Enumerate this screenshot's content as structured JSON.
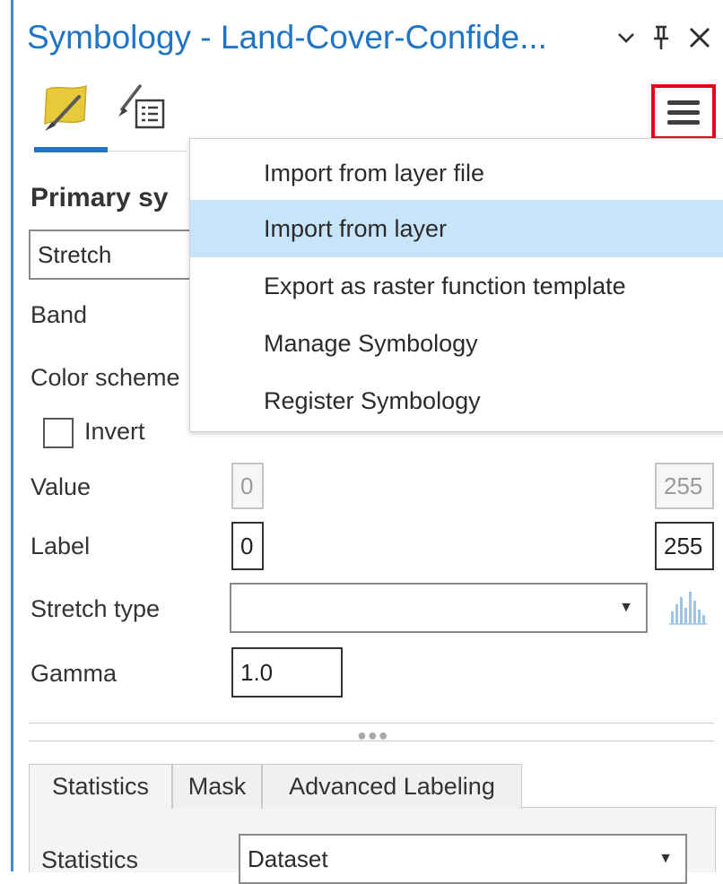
{
  "panel": {
    "title": "Symbology - Land-Cover-Confide...",
    "controls": {
      "dropdown_icon": "chevron-down-icon",
      "pin_icon": "pin-icon",
      "close_icon": "close-icon"
    },
    "accent_color": "#1f74c6",
    "highlight_color": "#e8001c"
  },
  "tabs": [
    {
      "name": "primary-symbology-tab",
      "icon": "paint-brush-icon",
      "active": true
    },
    {
      "name": "secondary-symbology-tab",
      "icon": "brush-list-icon",
      "active": false
    }
  ],
  "menu_button_icon": "hamburger-menu-icon",
  "menu": {
    "items": [
      {
        "label": "Import from layer file",
        "highlighted": false
      },
      {
        "label": "Import from layer",
        "highlighted": true
      },
      {
        "label": "Export as raster function template",
        "highlighted": false
      },
      {
        "label": "Manage Symbology",
        "highlighted": false
      },
      {
        "label": "Register Symbology",
        "highlighted": false
      }
    ]
  },
  "form": {
    "section_title": "Primary sy",
    "renderer_value": "Stretch",
    "band_label": "Band",
    "color_scheme_label": "Color scheme",
    "invert_label": "Invert",
    "value_label": "Value",
    "value_min": "0",
    "value_max": "255",
    "label_label": "Label",
    "label_min": "0",
    "label_max": "255",
    "stretch_type_label": "Stretch type",
    "stretch_type_value": "",
    "gamma_label": "Gamma",
    "gamma_value": "1.0"
  },
  "subtabs": [
    {
      "label": "Statistics",
      "active": true
    },
    {
      "label": "Mask",
      "active": false
    },
    {
      "label": "Advanced Labeling",
      "active": false
    }
  ],
  "statistics": {
    "label": "Statistics",
    "value": "Dataset"
  }
}
